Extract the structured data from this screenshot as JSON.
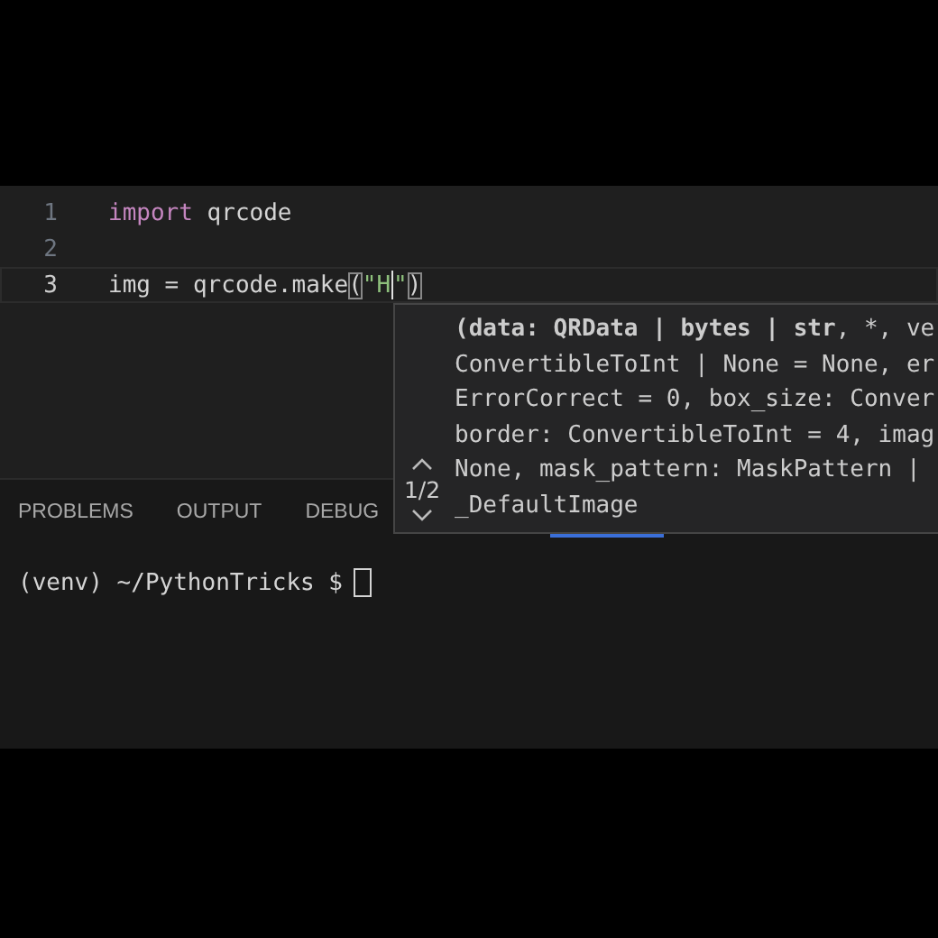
{
  "editor": {
    "lines": [
      {
        "number": "1",
        "current": false,
        "tokens": [
          {
            "kind": "keyword",
            "text": "import"
          },
          {
            "kind": "plain",
            "text": " qrcode"
          }
        ]
      },
      {
        "number": "2",
        "current": false
      },
      {
        "number": "3",
        "current": true,
        "tokens": [
          {
            "kind": "plain",
            "text": "img = qrcode.make"
          },
          {
            "kind": "bracket",
            "text": "("
          },
          {
            "kind": "string",
            "text": "\"H"
          },
          {
            "kind": "cursor"
          },
          {
            "kind": "string",
            "text": "\""
          },
          {
            "kind": "bracket",
            "text": ")"
          }
        ]
      }
    ]
  },
  "signature_help": {
    "lines": [
      "**(data: QRData | bytes | str**, *, ve",
      "ConvertibleToInt | None = None, er",
      "ErrorCorrect = 0, box_size: Conver",
      "border: ConvertibleToInt = 4, imag",
      "None, mask_pattern: MaskPattern |",
      "_DefaultImage"
    ],
    "counter": "1/2"
  },
  "panel": {
    "tabs": [
      {
        "label": "PROBLEMS",
        "selected": false
      },
      {
        "label": "OUTPUT",
        "selected": false
      },
      {
        "label": "DEBUG",
        "selected": false
      }
    ],
    "terminal": {
      "prompt": "(venv) ~/PythonTricks $"
    }
  }
}
